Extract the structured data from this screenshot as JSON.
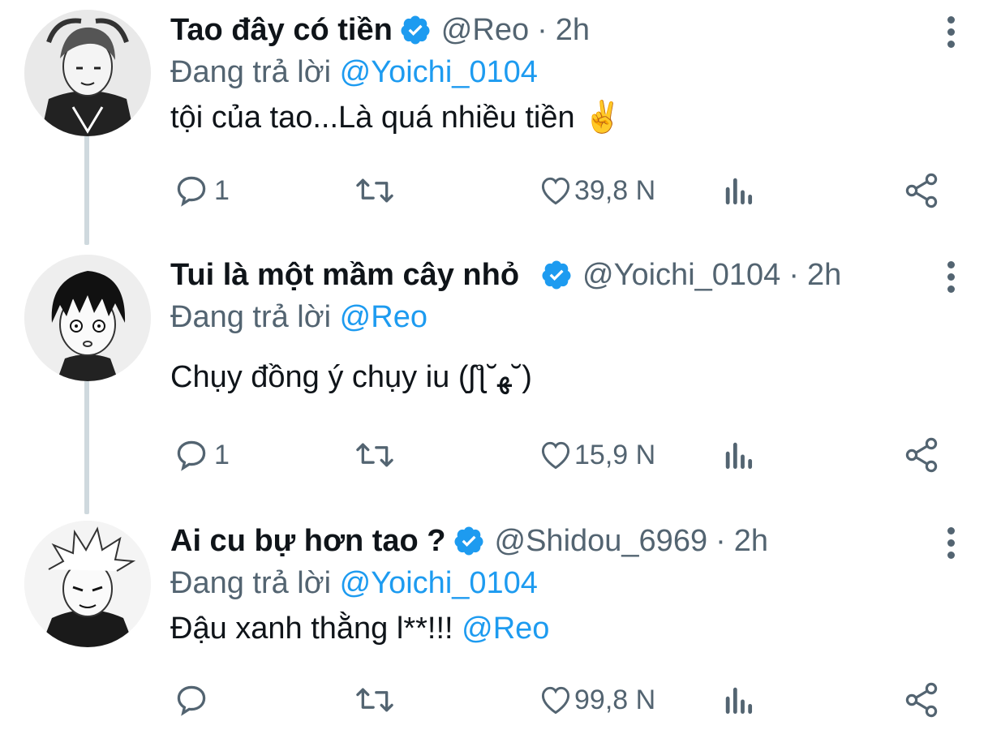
{
  "colors": {
    "accent": "#1d9bf0",
    "text": "#0f1419",
    "muted": "#536471",
    "thread": "#cfd9de"
  },
  "tweets": [
    {
      "name": "Tao đây có tiền",
      "handle": "@Reo",
      "dot": "·",
      "time": "2h",
      "reply_prefix": "Đang trả lời ",
      "reply_to": "@Yoichi_0104",
      "text": "tội của tao...Là quá nhiều tiền ✌️",
      "text_mention": "",
      "replies": "1",
      "retweets": "",
      "likes": "39,8 N",
      "icons": [
        "reply-icon",
        "retweet-icon",
        "heart-icon",
        "views-icon",
        "share-icon"
      ]
    },
    {
      "name": "Tui là một mầm cây nhỏ",
      "handle": "@Yoichi_0104",
      "dot": "·",
      "time": "2h",
      "reply_prefix": "Đang trả lời ",
      "reply_to": "@Reo",
      "text": "Chụy đồng ý chụy iu (ʃƪ˘ﻬ˘)",
      "text_mention": "",
      "replies": "1",
      "retweets": "",
      "likes": "15,9 N",
      "icons": [
        "reply-icon",
        "retweet-icon",
        "heart-icon",
        "views-icon",
        "share-icon"
      ]
    },
    {
      "name": "Ai cu bự hơn tao ?",
      "handle": "@Shidou_6969",
      "dot": "·",
      "time": "2h",
      "reply_prefix": "Đang trả lời ",
      "reply_to": "@Yoichi_0104",
      "text": "Đậu xanh thằng l**!!! ",
      "text_mention": "@Reo",
      "replies": "",
      "retweets": "",
      "likes": "99,8 N",
      "icons": [
        "reply-icon",
        "retweet-icon",
        "heart-icon",
        "views-icon",
        "share-icon"
      ]
    }
  ]
}
